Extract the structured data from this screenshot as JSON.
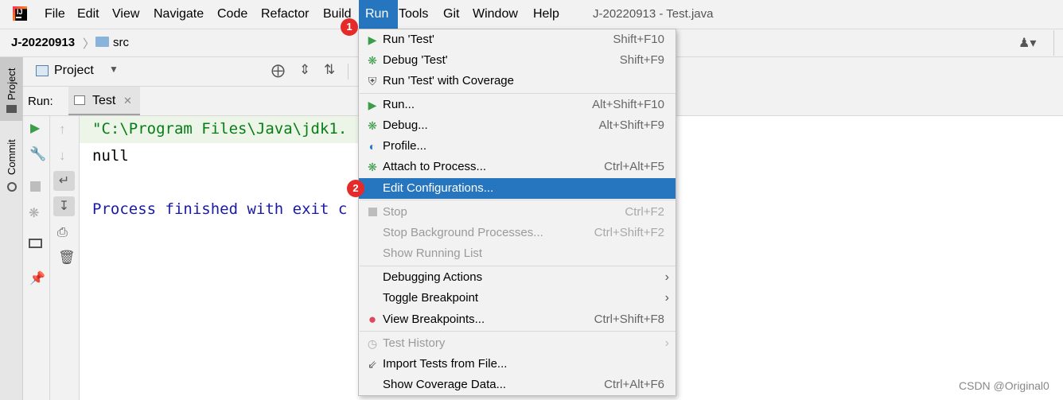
{
  "menubar": {
    "items": [
      "File",
      "Edit",
      "View",
      "Navigate",
      "Code",
      "Refactor",
      "Build",
      "Run",
      "Tools",
      "Git",
      "Window",
      "Help"
    ],
    "active": "Run",
    "window_title": "J-20220913 - Test.java"
  },
  "navbar": {
    "project": "J-20220913",
    "separator": "〉",
    "folder": "src"
  },
  "left_strip": {
    "project_tab": "Project",
    "commit_tab": "Commit"
  },
  "project_panel": {
    "label": "Project"
  },
  "run_panel": {
    "label": "Run:",
    "tab": "Test"
  },
  "console": {
    "cmd": "\"C:\\Program Files\\Java\\jdk1.",
    "output": "null",
    "exit": "Process finished with exit c"
  },
  "run_menu": {
    "items": [
      {
        "label": "Run 'Test'",
        "shortcut": "Shift+F10",
        "icon": "run-icon"
      },
      {
        "label": "Debug 'Test'",
        "shortcut": "Shift+F9",
        "icon": "debug-icon"
      },
      {
        "label": "Run 'Test' with Coverage",
        "shortcut": "",
        "icon": "coverage-icon"
      },
      {
        "label": "Run...",
        "shortcut": "Alt+Shift+F10",
        "icon": "run-icon"
      },
      {
        "label": "Debug...",
        "shortcut": "Alt+Shift+F9",
        "icon": "debug-icon"
      },
      {
        "label": "Profile...",
        "shortcut": "",
        "icon": "profile-icon"
      },
      {
        "label": "Attach to Process...",
        "shortcut": "Ctrl+Alt+F5",
        "icon": "attach-icon"
      },
      {
        "label": "Edit Configurations...",
        "shortcut": "",
        "icon": ""
      },
      {
        "label": "Stop",
        "shortcut": "Ctrl+F2",
        "icon": "stop-icon"
      },
      {
        "label": "Stop Background Processes...",
        "shortcut": "Ctrl+Shift+F2",
        "icon": ""
      },
      {
        "label": "Show Running List",
        "shortcut": "",
        "icon": ""
      },
      {
        "label": "Debugging Actions",
        "shortcut": "",
        "icon": ""
      },
      {
        "label": "Toggle Breakpoint",
        "shortcut": "",
        "icon": ""
      },
      {
        "label": "View Breakpoints...",
        "shortcut": "Ctrl+Shift+F8",
        "icon": "breakpoints-icon"
      },
      {
        "label": "Test History",
        "shortcut": "",
        "icon": "history-icon"
      },
      {
        "label": "Import Tests from File...",
        "shortcut": "",
        "icon": "import-icon"
      },
      {
        "label": "Show Coverage Data...",
        "shortcut": "Ctrl+Alt+F6",
        "icon": ""
      }
    ]
  },
  "badges": {
    "one": "1",
    "two": "2"
  },
  "colors": {
    "accent": "#2675bf",
    "badge": "#e52a2a",
    "console_green": "#067d17",
    "console_blue": "#1a1aa6"
  },
  "watermark": "CSDN @Original0"
}
